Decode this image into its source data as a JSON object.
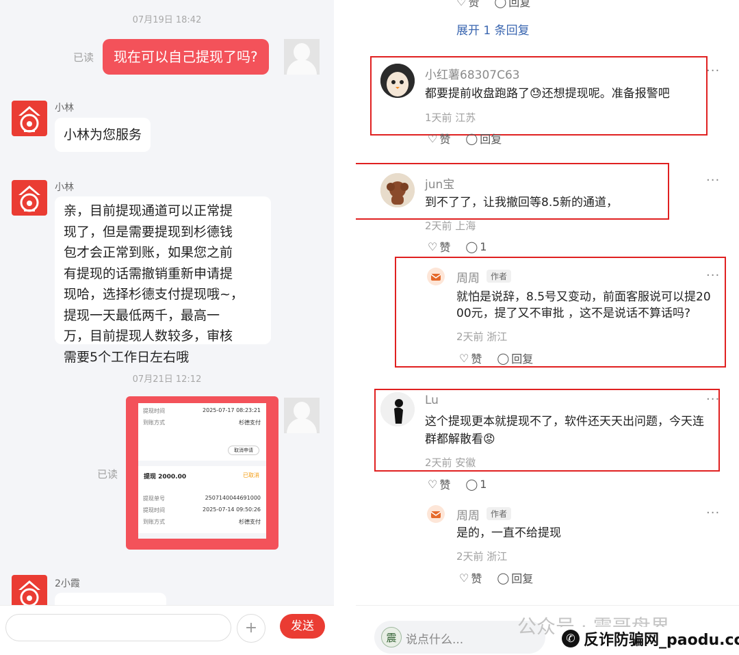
{
  "chat": {
    "timestamp1": "07月19日 18:42",
    "msg_user_1": "现在可以自己提现了吗?",
    "read1": "已读",
    "agent_name": "小林",
    "msg_agent_1": "小林为您服务",
    "msg_agent_2_lines": [
      "亲，目前提现通道可以正常提",
      "现了，但是需要提现到杉德钱",
      "包才会正常到账，如果您之前",
      "有提现的话需撤销重新申请提",
      "现哈，选择杉德支付提现哦~，",
      "提现一天最低两千，最高一",
      "万，目前提现人数较多，审核",
      "需要5个工作日左右哦"
    ],
    "timestamp2": "07月21日 12:12",
    "read2": "已读",
    "card": {
      "row1_label": "提现时间",
      "row1_value": "2025-07-17 08:23:21",
      "row2_label": "到账方式",
      "row2_value": "杉德支付",
      "cancel_label": "取消申请",
      "withdraw_title": "提现 2000.00",
      "withdraw_status": "已取消",
      "row3_label": "提现单号",
      "row3_value": "2507140044691000",
      "row4_label": "提现时间",
      "row4_value": "2025-07-14 09:50:26",
      "row5_label": "到账方式",
      "row5_value": "杉德支付"
    },
    "agent3_name": "2小霞",
    "send_label": "发送",
    "plus_label": "+"
  },
  "comments": {
    "top_actions": {
      "like": "赞",
      "reply": "回复"
    },
    "expand_label": "展开 1 条回复",
    "items": [
      {
        "name": "小红薯68307C63",
        "text": "都要提前收盘跑路了😓还想提现呢。准备报警吧",
        "meta": "1天前 江苏",
        "like": "赞",
        "reply": "回复"
      },
      {
        "name": "jun宝",
        "text": "到不了了，让我撤回等8.5新的通道，",
        "meta": "2天前 上海",
        "like": "赞",
        "reply": "1"
      },
      {
        "name": "周周",
        "tag": "作者",
        "text1": "就怕是说辞，8.5号又变动，前面客服说可以提20",
        "text2": "00元，提了又不审批 ，这不是说话不算话吗?",
        "meta": "2天前 浙江",
        "like": "赞",
        "reply": "回复"
      },
      {
        "name": "Lu",
        "text1": "这个提现更本就提现不了，软件还天天出问题，今天连",
        "text2": "群都解散看😡",
        "meta": "2天前 安徽",
        "like": "赞",
        "reply": "1"
      },
      {
        "name": "周周",
        "tag": "作者",
        "text": "是的，一直不给提现",
        "meta": "2天前 浙江",
        "like": "赞",
        "reply": "回复"
      }
    ],
    "input_placeholder": "说点什么...",
    "input_avatar": "震",
    "watermark": "公众号 · 震哥盘界",
    "site_badge": "反诈防骗网_paodu.cc",
    "more": "···"
  },
  "colors": {
    "brand_red": "#ea3c33",
    "bubble_red": "#f3525a",
    "box_red": "#e02020",
    "link_blue": "#3a66b0"
  }
}
